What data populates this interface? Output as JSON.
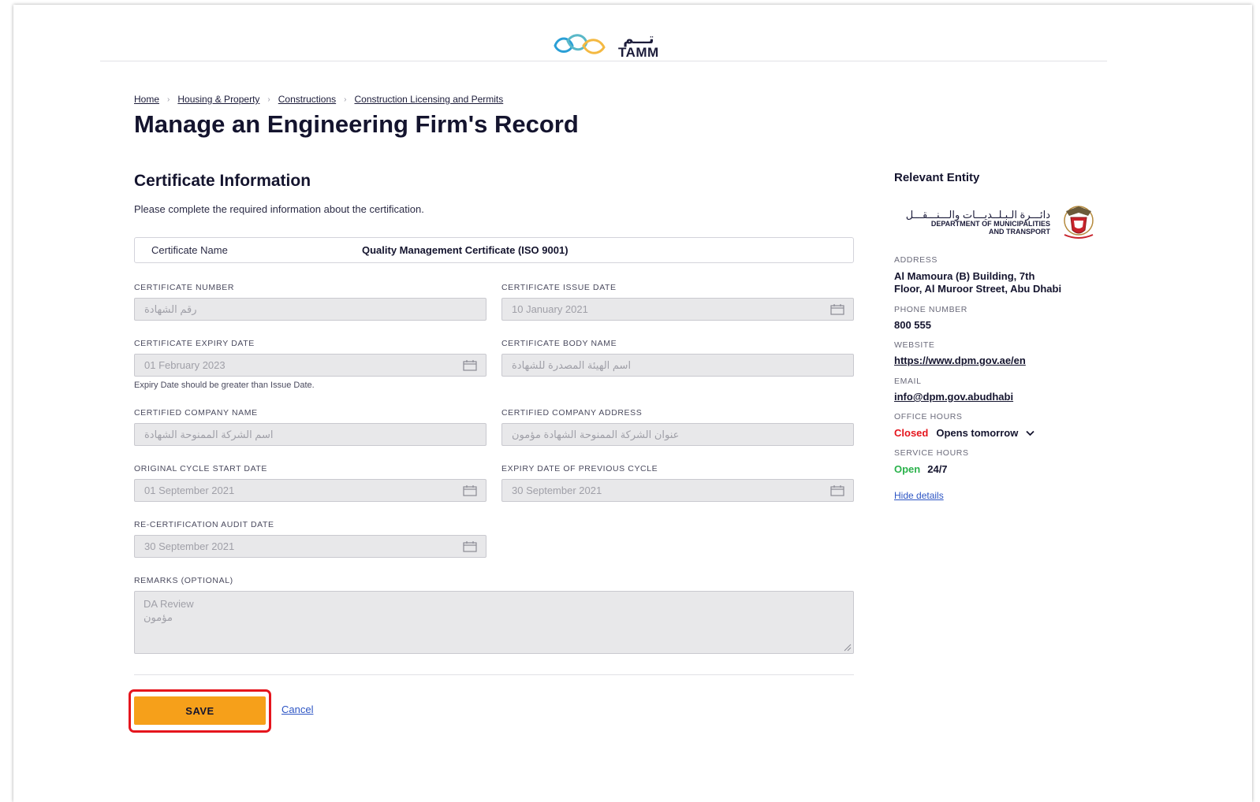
{
  "header": {
    "logo_ar": "تـــم",
    "logo_en": "TAMM"
  },
  "breadcrumb": [
    "Home",
    "Housing & Property",
    "Constructions",
    "Construction Licensing and Permits"
  ],
  "page_title": "Manage an Engineering Firm's Record",
  "form": {
    "section_title": "Certificate Information",
    "description": "Please complete the required information about the certification.",
    "certificate_name": {
      "label": "Certificate Name",
      "value": "Quality Management Certificate (ISO 9001)"
    },
    "certificate_number": {
      "label": "CERTIFICATE NUMBER",
      "placeholder": "رقم الشهادة"
    },
    "issue_date": {
      "label": "CERTIFICATE ISSUE DATE",
      "value": "10 January 2021"
    },
    "expiry_date": {
      "label": "CERTIFICATE EXPIRY DATE",
      "value": "01 February 2023",
      "hint": "Expiry Date should be greater than Issue Date."
    },
    "body_name": {
      "label": "CERTIFICATE BODY NAME",
      "placeholder": "اسم الهيئة المصدرة للشهادة"
    },
    "company_name": {
      "label": "CERTIFIED COMPANY NAME",
      "placeholder": "اسم الشركة الممنوحة الشهادة"
    },
    "company_address": {
      "label": "CERTIFIED COMPANY ADDRESS",
      "placeholder": "عنوان الشركة الممنوحة الشهادة مؤمون"
    },
    "cycle_start": {
      "label": "ORIGINAL CYCLE START DATE",
      "value": "01 September 2021"
    },
    "previous_expiry": {
      "label": "EXPIRY DATE OF PREVIOUS CYCLE",
      "value": "30 September 2021"
    },
    "audit_date": {
      "label": "RE-CERTIFICATION AUDIT DATE",
      "value": "30 September 2021"
    },
    "remarks": {
      "label": "REMARKS (OPTIONAL)",
      "line1": "DA Review",
      "line2": "مؤمون"
    },
    "save_label": "SAVE",
    "cancel_label": "Cancel"
  },
  "sidebar": {
    "title": "Relevant Entity",
    "entity_ar": "دائـــرة الـبـلــديـــات والـــنـــقـــل",
    "entity_en_line1": "DEPARTMENT OF MUNICIPALITIES",
    "entity_en_line2": "AND TRANSPORT",
    "address_label": "ADDRESS",
    "address_line1": "Al Mamoura (B) Building, 7th",
    "address_line2": "Floor, Al Muroor Street, Abu Dhabi",
    "phone_label": "PHONE NUMBER",
    "phone": "800 555",
    "website_label": "WEBSITE",
    "website": "https://www.dpm.gov.ae/en",
    "email_label": "EMAIL",
    "email": "info@dpm.gov.abudhabi",
    "office_hours_label": "OFFICE HOURS",
    "office_status": "Closed",
    "office_next": "Opens tomorrow",
    "service_hours_label": "SERVICE HOURS",
    "service_status": "Open",
    "service_hours": "24/7",
    "hide_details": "Hide details"
  },
  "colors": {
    "primary_button": "#f6a01a",
    "highlight": "#e5151d",
    "closed": "#e5151d",
    "open": "#2bb24c",
    "link": "#2d55c4"
  }
}
